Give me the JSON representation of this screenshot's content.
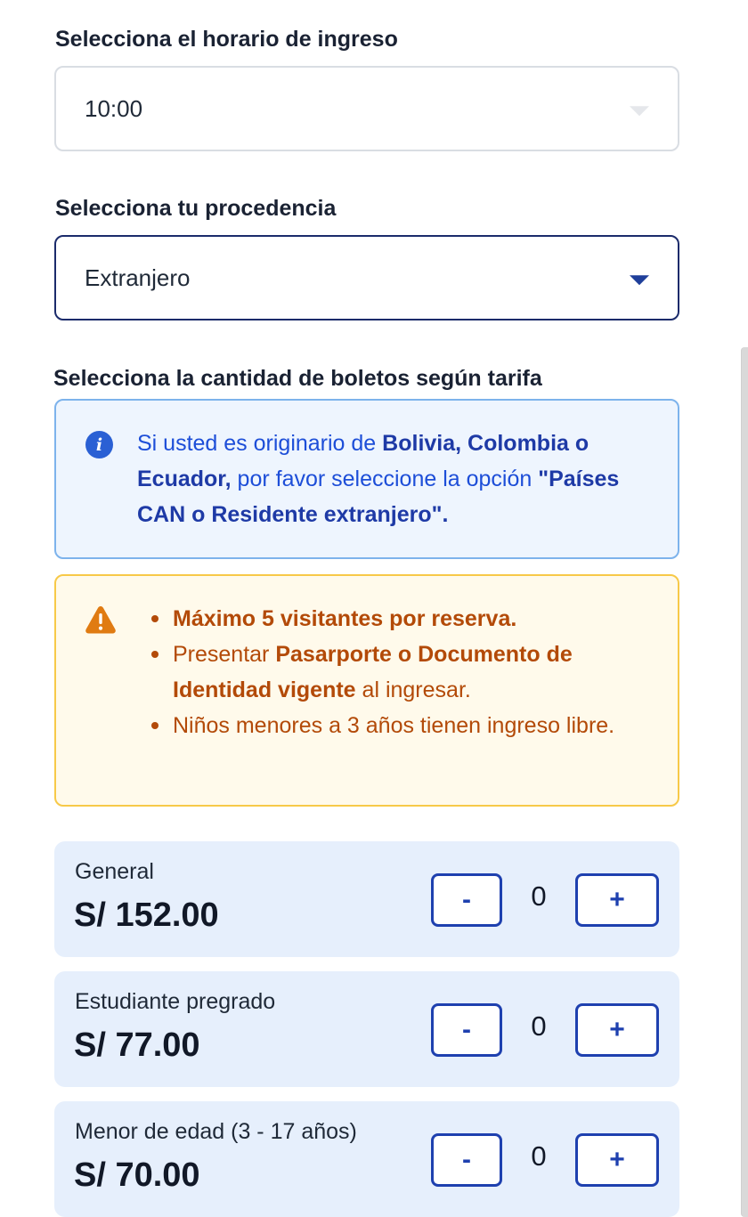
{
  "schedule": {
    "label": "Selecciona el horario de ingreso",
    "selected": "10:00"
  },
  "origin": {
    "label": "Selecciona tu procedencia",
    "selected": "Extranjero"
  },
  "tickets_section": {
    "label": "Selecciona la cantidad de boletos según tarifa"
  },
  "info_notice": {
    "icon": "info-icon",
    "text_1": "Si usted es originario de ",
    "bold_1": "Bolivia, Colombia o Ecuador,",
    "text_2": " por favor seleccione la opción ",
    "bold_2": "\"Países CAN o Residente extranjero\"."
  },
  "warning_notice": {
    "icon": "warning-triangle-icon",
    "item_1_bold": "Máximo 5 visitantes por reserva.",
    "item_2_text_1": "Presentar ",
    "item_2_bold": "Pasarporte o Documento de Identidad vigente",
    "item_2_text_2": " al ingresar.",
    "item_3": "Niños menores a 3 años tienen ingreso libre."
  },
  "tickets": [
    {
      "name": "General",
      "price": "S/ 152.00",
      "quantity": "0",
      "minus_label": "-",
      "plus_label": "+"
    },
    {
      "name": "Estudiante pregrado",
      "price": "S/ 77.00",
      "quantity": "0",
      "minus_label": "-",
      "plus_label": "+"
    },
    {
      "name": "Menor de edad (3 - 17 años)",
      "price": "S/ 70.00",
      "quantity": "0",
      "minus_label": "-",
      "plus_label": "+"
    }
  ],
  "colors": {
    "primary": "#1e40af",
    "info_bg": "#eef5fe",
    "warning_text": "#b34a08",
    "warning_bg": "#fffaeb",
    "ticket_bg": "#e6effc"
  }
}
